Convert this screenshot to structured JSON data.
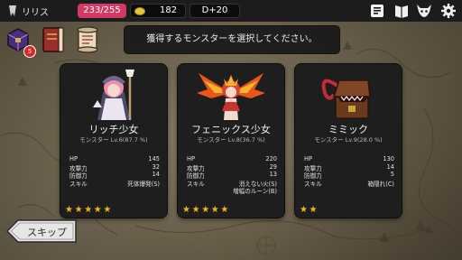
{
  "topbar": {
    "player_name": "リリス",
    "hp": "233/255",
    "gold": "182",
    "day": "D+20",
    "icons": [
      "rank-icon",
      "coin-icon",
      "inventory-icon",
      "book-icon",
      "demon-mask-icon",
      "settings-gear-icon"
    ]
  },
  "left_panel": {
    "badge_count": "5",
    "icons": [
      "treasure-chest-icon",
      "spellbook-icon",
      "scroll-icon"
    ]
  },
  "banner_text": "獲得するモンスターを選択してください。",
  "stat_labels": [
    "HP",
    "攻撃力",
    "防御力",
    "スキル"
  ],
  "cards": [
    {
      "name": "リッチ少女",
      "level": "モンスター Lv.6(87.7 %)",
      "hp": "145",
      "attack": "32",
      "defense": "14",
      "skills": [
        "死体爆発(S)"
      ],
      "stars": 5,
      "art": "lich-girl-sprite"
    },
    {
      "name": "フェニックス少女",
      "level": "モンスター Lv.8(36.7 %)",
      "hp": "220",
      "attack": "29",
      "defense": "13",
      "skills": [
        "消えない火(S)",
        "増幅のルーン(B)"
      ],
      "stars": 5,
      "art": "phoenix-girl-sprite"
    },
    {
      "name": "ミミック",
      "level": "モンスター Lv.9(28.0 %)",
      "hp": "130",
      "attack": "14",
      "defense": "5",
      "skills": [
        "箱隠れ(C)"
      ],
      "stars": 2,
      "art": "mimic-chest-sprite"
    }
  ],
  "skip_label": "スキップ",
  "colors": {
    "hp_pill": "#d23a64",
    "star": "#f2b51f",
    "card_bg": "#1e1e1e",
    "topbar_bg": "#1c1c1c"
  }
}
